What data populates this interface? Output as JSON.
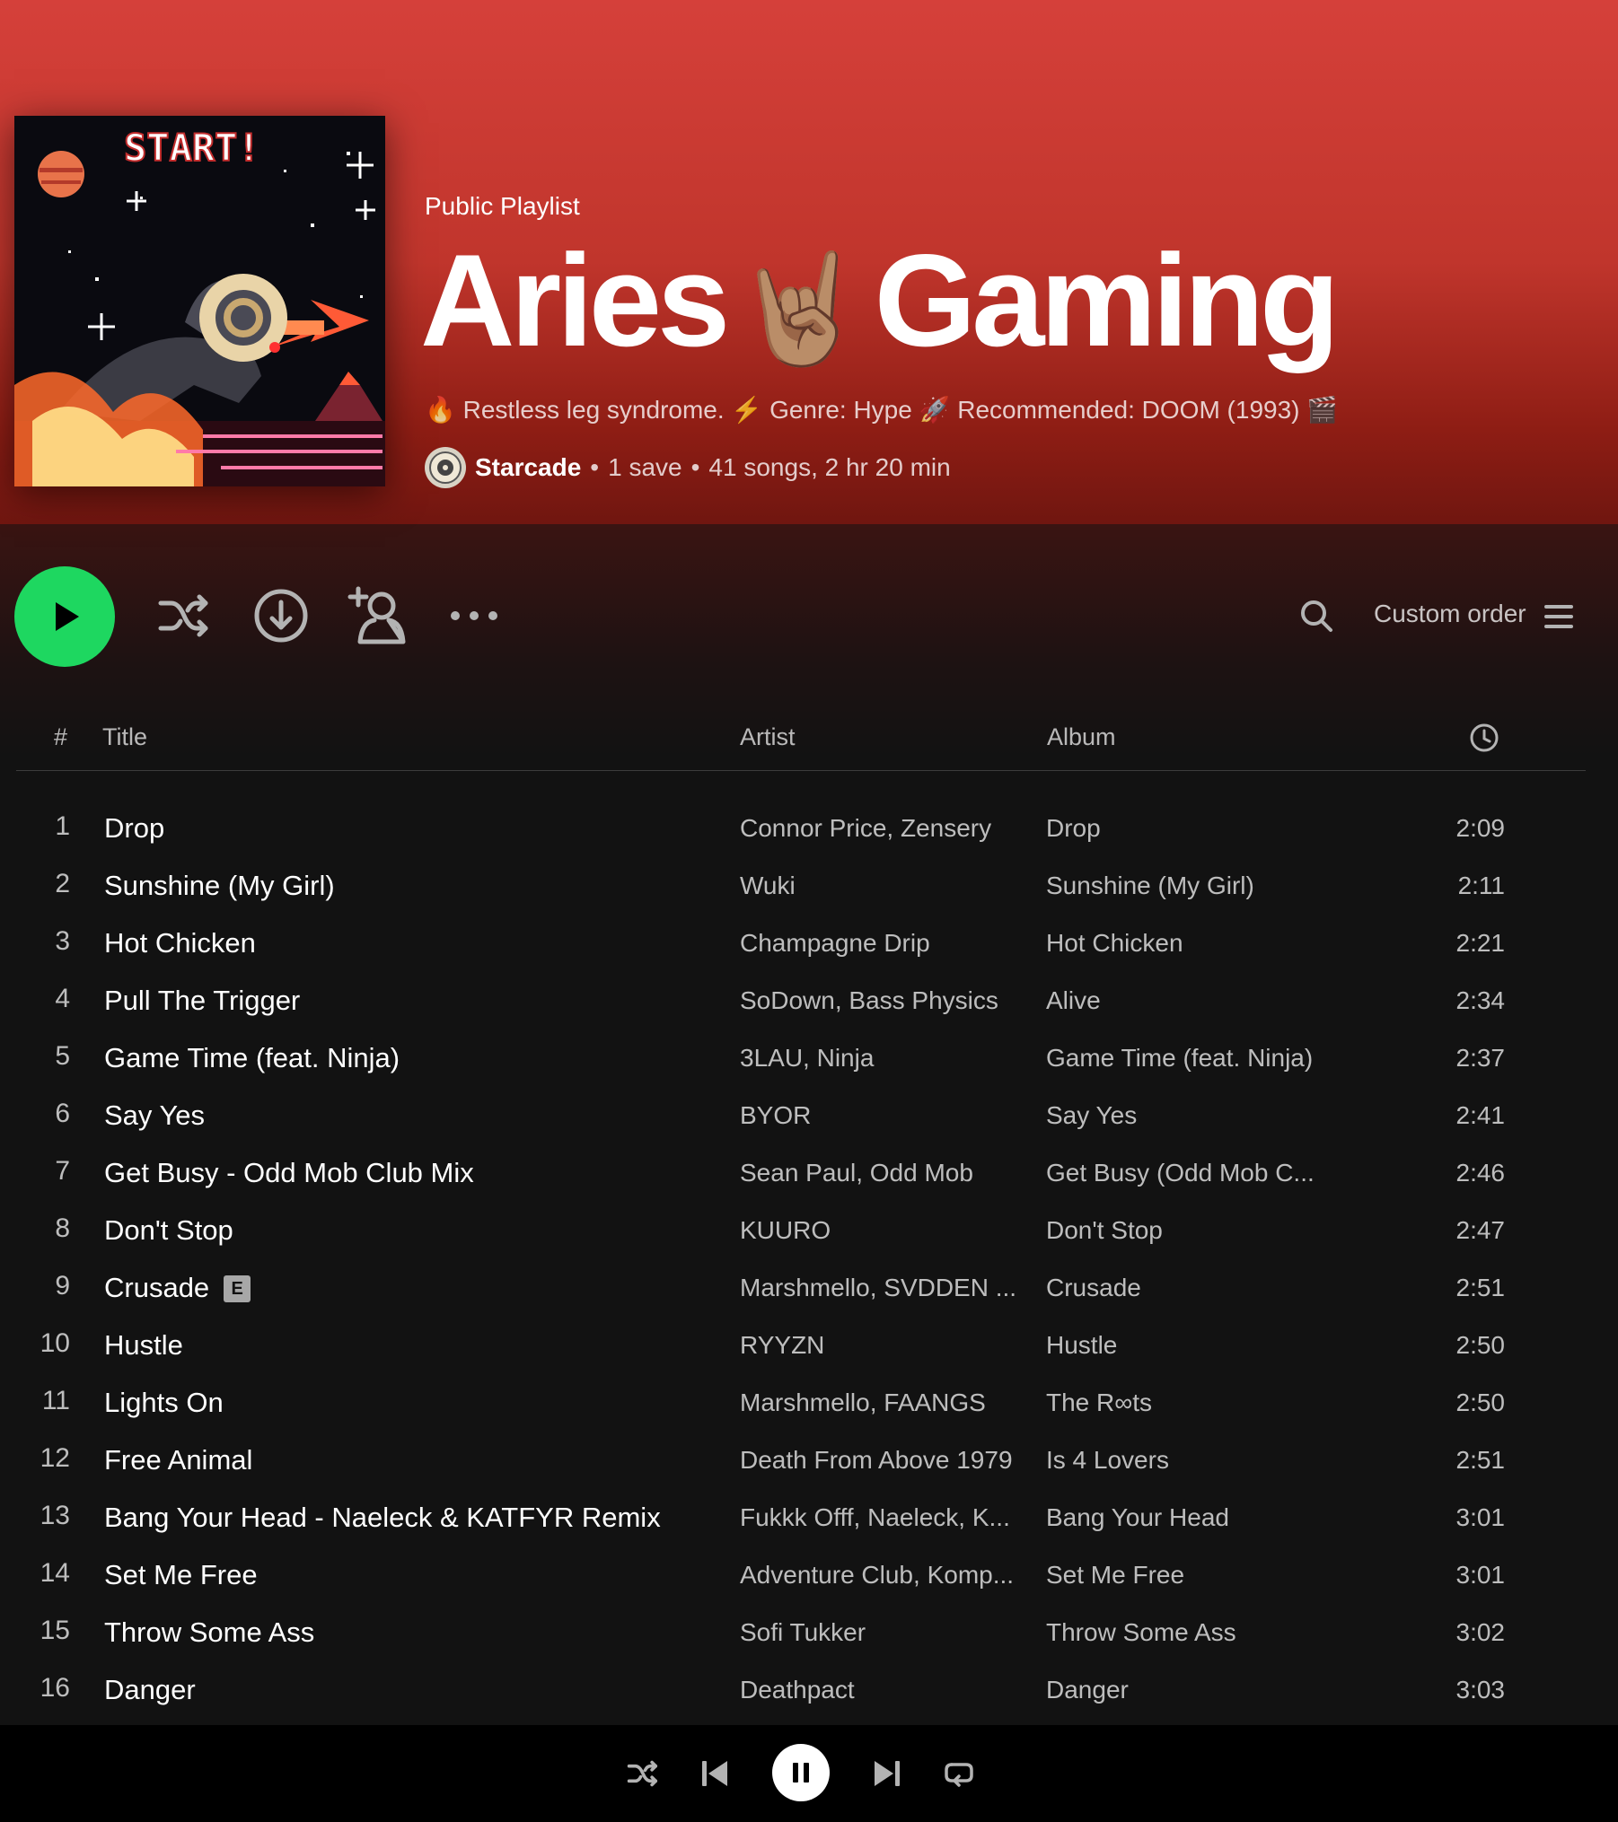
{
  "playlist": {
    "type": "Public Playlist",
    "title_part1": "Aries",
    "title_emoji": "🤘🏽",
    "title_part2": "Gaming",
    "description": "🔥 Restless leg syndrome. ⚡ Genre: Hype 🚀 Recommended: DOOM (1993) 🎬",
    "owner": "Starcade",
    "saves": "1 save",
    "stats": "41 songs, 2 hr 20 min",
    "cover_text": "START!"
  },
  "actions": {
    "sort_label": "Custom order"
  },
  "columns": {
    "num": "#",
    "title": "Title",
    "artist": "Artist",
    "album": "Album"
  },
  "tracks": [
    {
      "num": "1",
      "title": "Drop",
      "artist": "Connor Price, Zensery",
      "album": "Drop",
      "duration": "2:09"
    },
    {
      "num": "2",
      "title": "Sunshine (My Girl)",
      "artist": "Wuki",
      "album": "Sunshine (My Girl)",
      "duration": "2:11"
    },
    {
      "num": "3",
      "title": "Hot Chicken",
      "artist": "Champagne Drip",
      "album": "Hot Chicken",
      "duration": "2:21"
    },
    {
      "num": "4",
      "title": "Pull The Trigger",
      "artist": "SoDown, Bass Physics",
      "album": "Alive",
      "duration": "2:34"
    },
    {
      "num": "5",
      "title": "Game Time (feat. Ninja)",
      "artist": "3LAU, Ninja",
      "album": "Game Time (feat. Ninja)",
      "duration": "2:37"
    },
    {
      "num": "6",
      "title": "Say Yes",
      "artist": "BYOR",
      "album": "Say Yes",
      "duration": "2:41"
    },
    {
      "num": "7",
      "title": "Get Busy - Odd Mob Club Mix",
      "artist": "Sean Paul, Odd Mob",
      "album": "Get Busy (Odd Mob C...",
      "duration": "2:46"
    },
    {
      "num": "8",
      "title": "Don't Stop",
      "artist": "KUURO",
      "album": "Don't Stop",
      "duration": "2:47"
    },
    {
      "num": "9",
      "title": "Crusade",
      "explicit": "E",
      "artist": "Marshmello, SVDDEN ...",
      "album": "Crusade",
      "duration": "2:51"
    },
    {
      "num": "10",
      "title": "Hustle",
      "artist": "RYYZN",
      "album": "Hustle",
      "duration": "2:50"
    },
    {
      "num": "11",
      "title": "Lights On",
      "artist": "Marshmello, FAANGS",
      "album": "The R∞ts",
      "duration": "2:50"
    },
    {
      "num": "12",
      "title": "Free Animal",
      "artist": "Death From Above 1979",
      "album": "Is 4 Lovers",
      "duration": "2:51"
    },
    {
      "num": "13",
      "title": "Bang Your Head - Naeleck & KATFYR Remix",
      "artist": "Fukkk Offf, Naeleck, K...",
      "album": "Bang Your Head",
      "duration": "3:01"
    },
    {
      "num": "14",
      "title": "Set Me Free",
      "artist": "Adventure Club, Komp...",
      "album": "Set Me Free",
      "duration": "3:01"
    },
    {
      "num": "15",
      "title": "Throw Some Ass",
      "artist": "Sofi Tukker",
      "album": "Throw Some Ass",
      "duration": "3:02"
    },
    {
      "num": "16",
      "title": "Danger",
      "artist": "Deathpact",
      "album": "Danger",
      "duration": "3:03"
    }
  ],
  "colors": {
    "accent_green": "#1ed760",
    "hero_red": "#c0352c",
    "background": "#121212"
  },
  "icons": [
    "play-icon",
    "shuffle-icon",
    "download-icon",
    "add-user-icon",
    "more-icon",
    "search-icon",
    "list-icon",
    "clock-icon",
    "previous-icon",
    "pause-icon",
    "next-icon",
    "repeat-icon"
  ]
}
